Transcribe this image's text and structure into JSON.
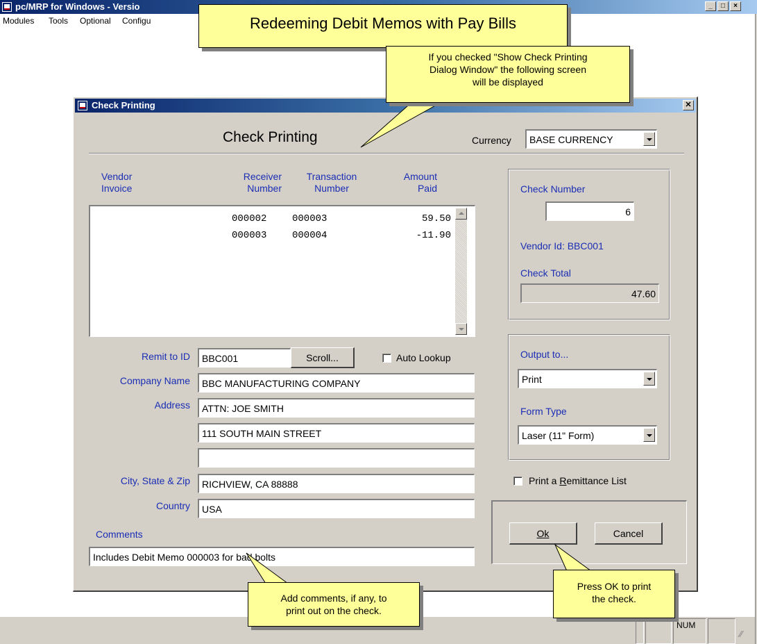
{
  "app": {
    "title": "pc/MRP for Windows - Versio",
    "menu": [
      "Modules",
      "Tools",
      "Optional",
      "Configu"
    ],
    "status_num": "NUM"
  },
  "callouts": {
    "banner": "Redeeming Debit Memos with Pay Bills",
    "dialog_note": [
      "If you checked \"Show Check Printing",
      "Dialog Window\" the following screen",
      "will be displayed"
    ],
    "comments_note": [
      "Add comments, if any, to",
      "print out on the check."
    ],
    "ok_note": [
      "Press OK to print",
      "the check."
    ]
  },
  "dialog": {
    "title": "Check Printing",
    "heading": "Check Printing",
    "currency_label": "Currency",
    "currency_value": "BASE CURRENCY",
    "columns": {
      "vendor_invoice": [
        "Vendor",
        "Invoice"
      ],
      "receiver_number": [
        "Receiver",
        "Number"
      ],
      "transaction_number": [
        "Transaction",
        "Number"
      ],
      "amount_paid": [
        "Amount",
        "Paid"
      ]
    },
    "rows": [
      {
        "vendor_invoice": "",
        "receiver": "000002",
        "transaction": "000003",
        "amount": "59.50"
      },
      {
        "vendor_invoice": "",
        "receiver": "000003",
        "transaction": "000004",
        "amount": "-11.90"
      }
    ],
    "check_number_label": "Check Number",
    "check_number": "6",
    "vendor_id_label": "Vendor Id:",
    "vendor_id": "BBC001",
    "check_total_label": "Check Total",
    "check_total": "47.60",
    "remit_to_label": "Remit to ID",
    "remit_to": "BBC001",
    "scroll_button": "Scroll...",
    "auto_lookup": "Auto Lookup",
    "company_name_label": "Company Name",
    "company_name": "BBC MANUFACTURING COMPANY",
    "address_label": "Address",
    "address1": "ATTN: JOE SMITH",
    "address2": "111 SOUTH MAIN STREET",
    "address3": "",
    "city_label": "City, State & Zip",
    "city": "RICHVIEW, CA 88888",
    "country_label": "Country",
    "country": "USA",
    "comments_label": "Comments",
    "comments": "Includes Debit Memo 000003 for bad bolts",
    "output_to_label": "Output to...",
    "output_to": "Print",
    "form_type_label": "Form Type",
    "form_type": "Laser  (11\" Form)",
    "remittance_label": "Print a Remittance List",
    "ok_button": "Ok",
    "cancel_button": "Cancel"
  }
}
